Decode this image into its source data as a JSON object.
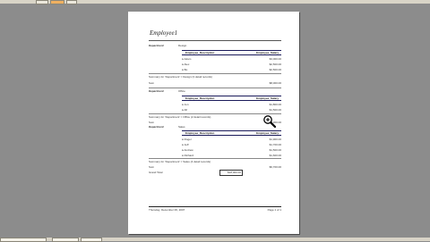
{
  "report": {
    "title": "Employee1",
    "footer_left": "Thursday, December 06, 2007",
    "footer_right": "Page 1 of 1",
    "groups": [
      {
        "label": "Department",
        "value": "Design",
        "col_left": "Employee_Description",
        "col_right": "Employee_Salary",
        "rows": [
          {
            "name": "Adam",
            "salary": "$3,000.00"
          },
          {
            "name": "Alex",
            "salary": "$2,500.00"
          },
          {
            "name": "Bo",
            "salary": "$2,500.00"
          }
        ],
        "summary_text": "Summary for 'Department' = Design (3 detail records)",
        "sum_label": "Sum",
        "sum_value": "$8,000.00"
      },
      {
        "label": "Department",
        "value": "Office",
        "col_left": "Employee_Description",
        "col_right": "Employee_Salary",
        "rows": [
          {
            "name": "Jon",
            "salary": "$1,800.00"
          },
          {
            "name": "Alf",
            "salary": "$1,500.00"
          }
        ],
        "summary_text": "Summary for 'Department' = Office (2 detail records)",
        "sum_label": "Sum",
        "sum_value": "$3,300.00"
      },
      {
        "label": "Department",
        "value": "Sales",
        "col_left": "Employee_Description",
        "col_right": "Employee_Salary",
        "rows": [
          {
            "name": "Roger",
            "salary": "$1,900.00"
          },
          {
            "name": "Jeff",
            "salary": "$1,700.00"
          },
          {
            "name": "Andrew",
            "salary": "$1,500.00"
          },
          {
            "name": "Richard",
            "salary": "$1,600.00"
          }
        ],
        "summary_text": "Summary for 'Department' = Sales (4 detail records)",
        "sum_label": "Sum",
        "sum_value": "$6,700.00"
      }
    ],
    "grand_total_label": "Grand Total",
    "grand_total_value": "$18,000.00"
  },
  "cursor": {
    "icon": "zoom-in-magnifier-icon"
  }
}
